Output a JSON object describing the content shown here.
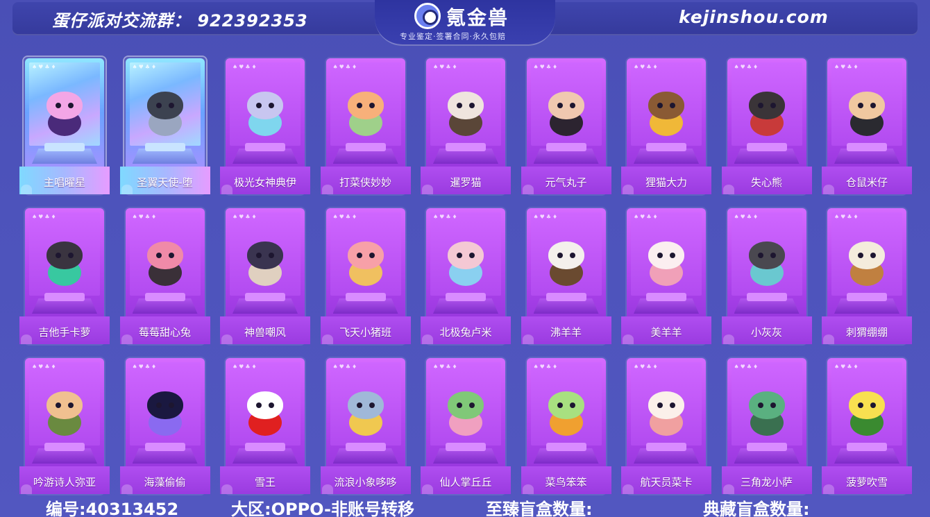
{
  "header": {
    "group_text": "蛋仔派对交流群： 922392353",
    "logo_name": "氪金兽",
    "logo_tagline": "专业鉴定·签署合同·永久包赔",
    "site": "kejinshou.com"
  },
  "card_suits": "♠♥♣♦",
  "items": [
    {
      "name": "主唱曜星",
      "rarity": "special",
      "color": "#f3a6e6",
      "accent": "#4a2a7a"
    },
    {
      "name": "圣翼天使-堕",
      "rarity": "special",
      "color": "#3c4250",
      "accent": "#9aa6c0"
    },
    {
      "name": "极光女神典伊",
      "rarity": "normal",
      "color": "#c8c6f0",
      "accent": "#7fd6ee"
    },
    {
      "name": "打菜侠妙妙",
      "rarity": "normal",
      "color": "#f7b07a",
      "accent": "#9fd08a"
    },
    {
      "name": "暹罗猫",
      "rarity": "normal",
      "color": "#efe4de",
      "accent": "#5a4638"
    },
    {
      "name": "元气丸子",
      "rarity": "normal",
      "color": "#f0c8b0",
      "accent": "#2c2430"
    },
    {
      "name": "狸猫大力",
      "rarity": "normal",
      "color": "#8a5a34",
      "accent": "#f0b838"
    },
    {
      "name": "失心熊",
      "rarity": "normal",
      "color": "#3a3438",
      "accent": "#c83a3a"
    },
    {
      "name": "仓鼠米仔",
      "rarity": "normal",
      "color": "#f0c8a0",
      "accent": "#2a2a30"
    },
    {
      "name": "吉他手卡萝",
      "rarity": "normal",
      "color": "#3a3440",
      "accent": "#38c8a0"
    },
    {
      "name": "莓莓甜心兔",
      "rarity": "normal",
      "color": "#f08aa8",
      "accent": "#3a3038"
    },
    {
      "name": "神兽嘲风",
      "rarity": "normal",
      "color": "#3a3450",
      "accent": "#e0d0c0"
    },
    {
      "name": "飞天小猪班",
      "rarity": "normal",
      "color": "#f7a0a8",
      "accent": "#f0c060"
    },
    {
      "name": "北极兔卢米",
      "rarity": "normal",
      "color": "#f4c8d4",
      "accent": "#8ad0f0"
    },
    {
      "name": "沸羊羊",
      "rarity": "normal",
      "color": "#f4f0ec",
      "accent": "#6a4a30"
    },
    {
      "name": "美羊羊",
      "rarity": "normal",
      "color": "#fbeef0",
      "accent": "#f0a0b8"
    },
    {
      "name": "小灰灰",
      "rarity": "normal",
      "color": "#4a4850",
      "accent": "#6ac8d0"
    },
    {
      "name": "刺猬绷绷",
      "rarity": "normal",
      "color": "#f4ecdc",
      "accent": "#c08040"
    },
    {
      "name": "吟游诗人弥亚",
      "rarity": "normal",
      "color": "#f0c090",
      "accent": "#6a8a40"
    },
    {
      "name": "海藻偷偷",
      "rarity": "normal",
      "color": "#1a1840",
      "accent": "#8a6af0"
    },
    {
      "name": "雪王",
      "rarity": "normal",
      "color": "#ffffff",
      "accent": "#e02020"
    },
    {
      "name": "流浪小象哆哆",
      "rarity": "normal",
      "color": "#a0b8d8",
      "accent": "#f0c850"
    },
    {
      "name": "仙人掌丘丘",
      "rarity": "normal",
      "color": "#80c878",
      "accent": "#f0a0c0"
    },
    {
      "name": "菜鸟笨笨",
      "rarity": "normal",
      "color": "#a8e080",
      "accent": "#f0a030"
    },
    {
      "name": "航天员菜卡",
      "rarity": "normal",
      "color": "#fbf0ea",
      "accent": "#f0a0a0"
    },
    {
      "name": "三角龙小萨",
      "rarity": "normal",
      "color": "#5ab080",
      "accent": "#3a7050"
    },
    {
      "name": "菠萝吹雪",
      "rarity": "normal",
      "color": "#f8e050",
      "accent": "#3a8a30"
    }
  ],
  "footer": {
    "id_text": "编号:40313452",
    "server_text": "大区:OPPO-非账号转移",
    "premium_box_text": "至臻盲盒数量:",
    "collection_box_text": "典藏盲盒数量:"
  }
}
